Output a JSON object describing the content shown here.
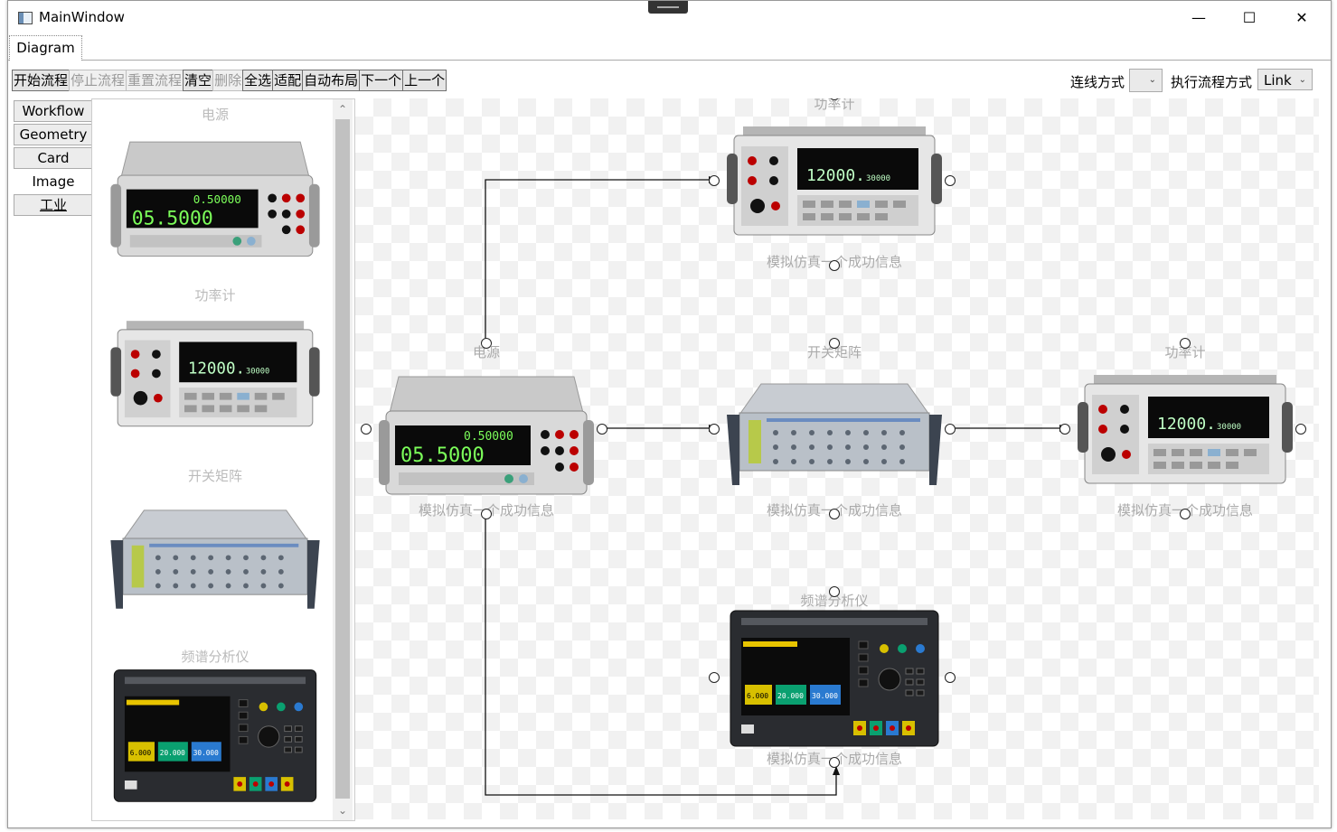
{
  "window": {
    "title": "MainWindow",
    "minimize": "—",
    "maximize": "☐",
    "close": "✕"
  },
  "tabs": {
    "diagram": "Diagram"
  },
  "toolbar": {
    "buttons": [
      "开始流程",
      "停止流程",
      "重置流程",
      "清空",
      "删除",
      "全选",
      "适配",
      "自动布局",
      "下一个",
      "上一个"
    ],
    "disabled": [
      "停止流程",
      "重置流程",
      "删除"
    ],
    "link_mode_label": "连线方式",
    "link_mode_value": "",
    "exec_mode_label": "执行流程方式",
    "exec_mode_value": "Link"
  },
  "side_tabs": [
    "Workflow",
    "Geometry",
    "Card",
    "Image",
    "工业"
  ],
  "active_side_tab": "Image",
  "palette": {
    "items": [
      {
        "label": "电源",
        "device": "power-supply"
      },
      {
        "label": "功率计",
        "device": "power-meter"
      },
      {
        "label": "开关矩阵",
        "device": "switch-matrix"
      },
      {
        "label": "频谱分析仪",
        "device": "spectrum-analyzer"
      }
    ]
  },
  "canvas": {
    "nodes": [
      {
        "id": "power",
        "title": "电源",
        "message": "模拟仿真一个成功信息",
        "device": "power-supply"
      },
      {
        "id": "meter-top",
        "title": "功率计",
        "message": "模拟仿真一个成功信息",
        "device": "power-meter"
      },
      {
        "id": "switch",
        "title": "开关矩阵",
        "message": "模拟仿真一个成功信息",
        "device": "switch-matrix"
      },
      {
        "id": "meter-right",
        "title": "功率计",
        "message": "模拟仿真一个成功信息",
        "device": "power-meter"
      },
      {
        "id": "spectrum",
        "title": "频谱分析仪",
        "message": "模拟仿真一个成功信息",
        "device": "spectrum-analyzer"
      }
    ],
    "links": [
      {
        "from": "power",
        "to": "meter-top"
      },
      {
        "from": "power",
        "to": "switch"
      },
      {
        "from": "switch",
        "to": "meter-right"
      },
      {
        "from": "power",
        "to": "spectrum"
      }
    ]
  },
  "device_display": {
    "power_supply_top": "0.50000",
    "power_supply_main": "05.5000",
    "power_meter_main": "12000.",
    "power_meter_sub": "30000",
    "spectrum_readings": [
      "6.000",
      "20.000",
      "30.000"
    ]
  }
}
